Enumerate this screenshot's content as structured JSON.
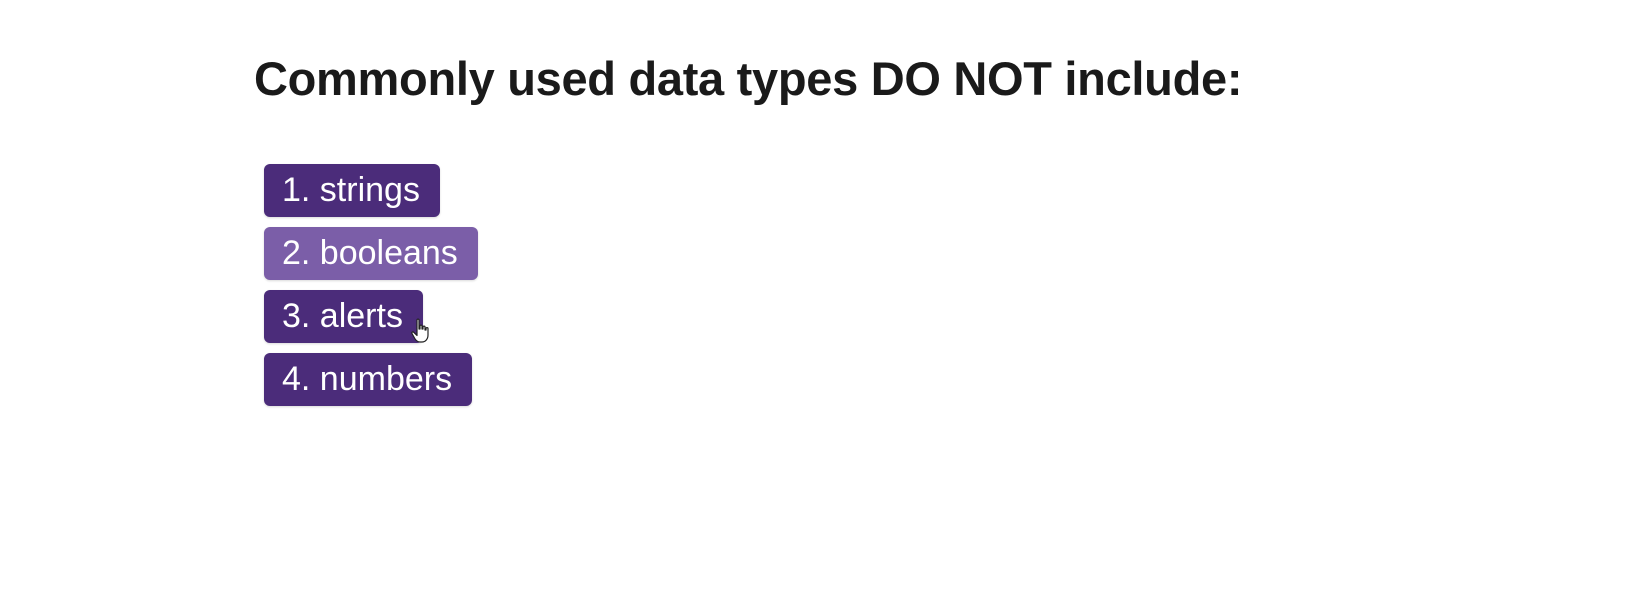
{
  "question": "Commonly used data types DO NOT include:",
  "choices": [
    {
      "label": "1. strings",
      "state": "default"
    },
    {
      "label": "2. booleans",
      "state": "hover"
    },
    {
      "label": "3. alerts",
      "state": "default"
    },
    {
      "label": "4. numbers",
      "state": "default"
    }
  ],
  "colors": {
    "button": "#4b2c7a",
    "button_hover": "#7b5ea8",
    "text": "#1a1a1a",
    "button_text": "#ffffff"
  },
  "icons": {
    "cursor": "hand-pointer-icon"
  }
}
